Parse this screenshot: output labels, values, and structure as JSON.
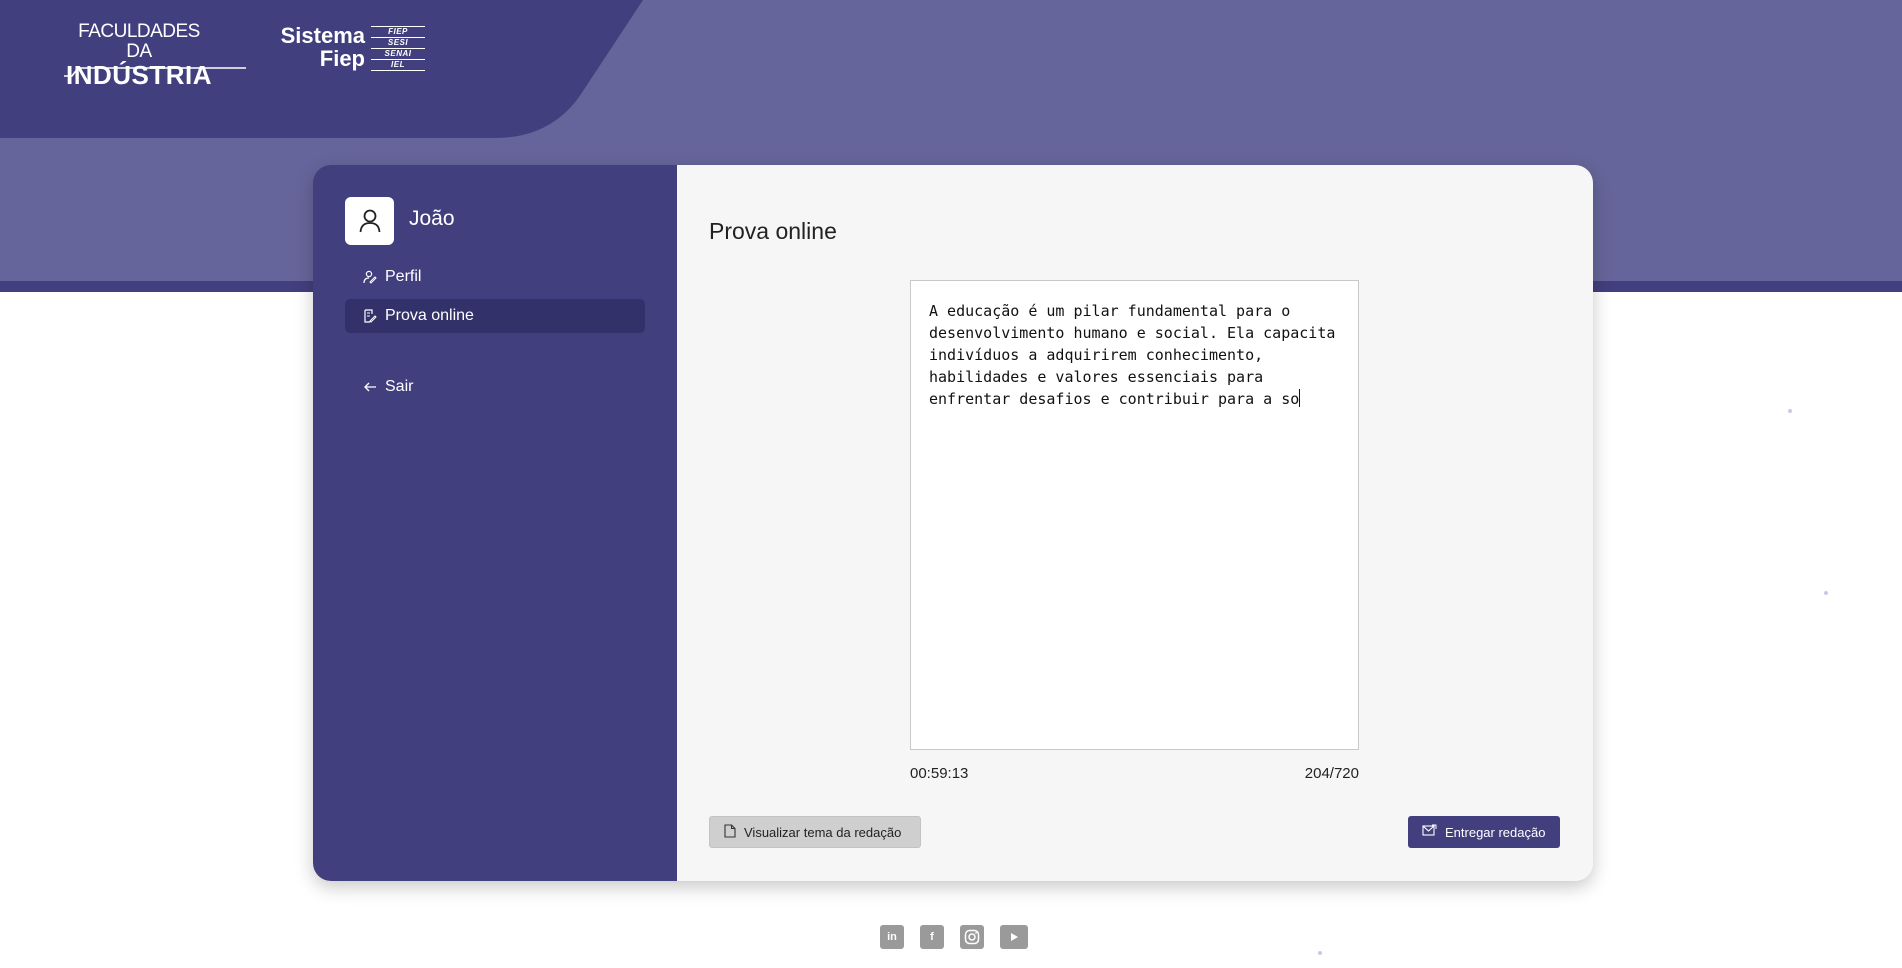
{
  "header": {
    "logo_fi_line1": "FACULDADES DA",
    "logo_fi_line2": "INDÚSTRIA",
    "logo_sf_line1": "Sistema",
    "logo_sf_line2": "Fiep",
    "logo_sf_tags": [
      "FIEP",
      "SESI",
      "SENAI",
      "IEL"
    ]
  },
  "sidebar": {
    "user_name": "João",
    "items": [
      {
        "label": "Perfil",
        "icon": "user-edit-icon",
        "active": false
      },
      {
        "label": "Prova online",
        "icon": "document-edit-icon",
        "active": true
      }
    ],
    "logout_label": "Sair"
  },
  "main": {
    "title": "Prova online",
    "essay_text": "A educação é um pilar fundamental para o desenvolvimento humano e social. Ela capacita indivíduos a adquirirem conhecimento, habilidades e valores essenciais para enfrentar desafios e contribuir para a so",
    "timer": "00:59:13",
    "char_count": "204/720",
    "view_theme_label": "Visualizar tema da redação",
    "submit_label": "Entregar redação"
  },
  "footer": {
    "social": [
      "linkedin-icon",
      "facebook-icon",
      "instagram-icon",
      "youtube-icon"
    ]
  },
  "colors": {
    "primary": "#423f7e",
    "header_band": "#66659b",
    "content_bg": "#f6f6f6"
  }
}
